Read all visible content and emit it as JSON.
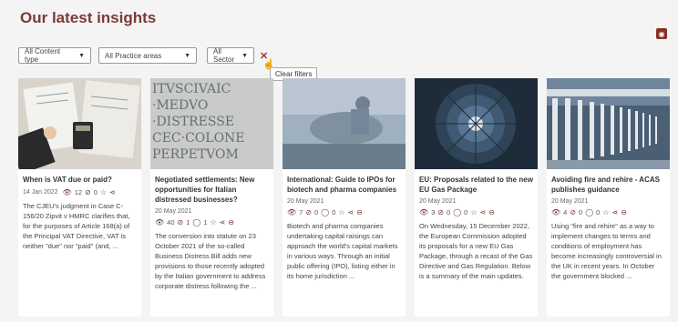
{
  "page": {
    "title": "Our latest insights"
  },
  "filters": {
    "content_type": "All Content type",
    "practice_areas": "All Practice areas",
    "sector": "All Sector",
    "clear_tooltip": "Clear filters"
  },
  "icons": {
    "rss": "rss-icon",
    "views": "eye-icon",
    "likes": "check-circle-icon",
    "comments": "comment-icon",
    "favorite": "star-icon",
    "share": "share-icon",
    "more": "more-circle-icon"
  },
  "colors": {
    "brand": "#7a3b36",
    "rss": "#8b2e24"
  },
  "cards": [
    {
      "title": "When is VAT due or paid?",
      "date": "14 Jan 2022",
      "views": "12",
      "likes": "0",
      "comments": "",
      "excerpt": "The CJEU's judgment in Case C-156/20 Zipvit v HMRC clarifies that, for the purposes of Article 168(a) of the Principal VAT Directive, VAT is neither \"due\" nor \"paid\" (and, ..."
    },
    {
      "title": "Negotiated settlements: New opportunities for Italian distressed businesses?",
      "date": "20 May 2021",
      "views": "40",
      "likes": "1",
      "comments": "1",
      "excerpt": "The conversion into statute on 23 October 2021 of the so-called Business Distress Bill adds new provisions to those recently adopted by the Italian government to address corporate distress following the ..."
    },
    {
      "title": "International: Guide to IPOs for biotech and pharma companies",
      "date": "20 May 2021",
      "views": "7",
      "likes": "0",
      "comments": "0",
      "excerpt": "Biotech and pharma companies undertaking capital raisings can approach the world's capital markets in various ways. Through an initial public offering (IPO), listing either in its home jurisdiction ..."
    },
    {
      "title": "EU: Proposals related to the new EU Gas Package",
      "date": "20 May 2021",
      "views": "3",
      "likes": "0",
      "comments": "0",
      "excerpt": "On Wednesday, 15 December 2022, the European Commission adopted its proposals for a new EU Gas Package, through a recast of the Gas Directive and Gas Regulation. Below is a summary of the main updates."
    },
    {
      "title": "Avoiding fire and rehire - ACAS publishes guidance",
      "date": "20 May 2021",
      "views": "4",
      "likes": "0",
      "comments": "0",
      "excerpt": "Using \"fire and rehire\" as a way to implement changes to terms and conditions of employment has become increasingly controversial in the UK in recent years. In October the government blocked ..."
    }
  ]
}
